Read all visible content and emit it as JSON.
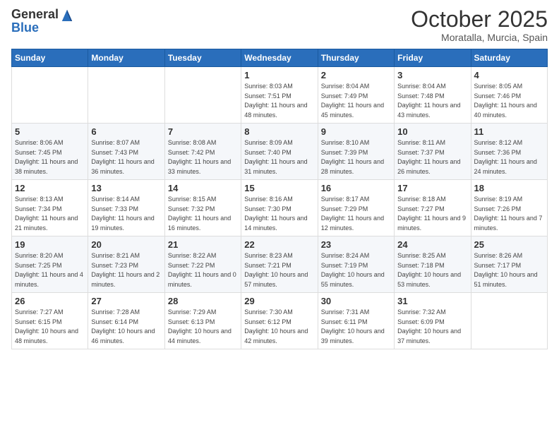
{
  "header": {
    "logo_general": "General",
    "logo_blue": "Blue",
    "month": "October 2025",
    "location": "Moratalla, Murcia, Spain"
  },
  "days_of_week": [
    "Sunday",
    "Monday",
    "Tuesday",
    "Wednesday",
    "Thursday",
    "Friday",
    "Saturday"
  ],
  "weeks": [
    [
      {
        "day": "",
        "sunrise": "",
        "sunset": "",
        "daylight": ""
      },
      {
        "day": "",
        "sunrise": "",
        "sunset": "",
        "daylight": ""
      },
      {
        "day": "",
        "sunrise": "",
        "sunset": "",
        "daylight": ""
      },
      {
        "day": "1",
        "sunrise": "Sunrise: 8:03 AM",
        "sunset": "Sunset: 7:51 PM",
        "daylight": "Daylight: 11 hours and 48 minutes."
      },
      {
        "day": "2",
        "sunrise": "Sunrise: 8:04 AM",
        "sunset": "Sunset: 7:49 PM",
        "daylight": "Daylight: 11 hours and 45 minutes."
      },
      {
        "day": "3",
        "sunrise": "Sunrise: 8:04 AM",
        "sunset": "Sunset: 7:48 PM",
        "daylight": "Daylight: 11 hours and 43 minutes."
      },
      {
        "day": "4",
        "sunrise": "Sunrise: 8:05 AM",
        "sunset": "Sunset: 7:46 PM",
        "daylight": "Daylight: 11 hours and 40 minutes."
      }
    ],
    [
      {
        "day": "5",
        "sunrise": "Sunrise: 8:06 AM",
        "sunset": "Sunset: 7:45 PM",
        "daylight": "Daylight: 11 hours and 38 minutes."
      },
      {
        "day": "6",
        "sunrise": "Sunrise: 8:07 AM",
        "sunset": "Sunset: 7:43 PM",
        "daylight": "Daylight: 11 hours and 36 minutes."
      },
      {
        "day": "7",
        "sunrise": "Sunrise: 8:08 AM",
        "sunset": "Sunset: 7:42 PM",
        "daylight": "Daylight: 11 hours and 33 minutes."
      },
      {
        "day": "8",
        "sunrise": "Sunrise: 8:09 AM",
        "sunset": "Sunset: 7:40 PM",
        "daylight": "Daylight: 11 hours and 31 minutes."
      },
      {
        "day": "9",
        "sunrise": "Sunrise: 8:10 AM",
        "sunset": "Sunset: 7:39 PM",
        "daylight": "Daylight: 11 hours and 28 minutes."
      },
      {
        "day": "10",
        "sunrise": "Sunrise: 8:11 AM",
        "sunset": "Sunset: 7:37 PM",
        "daylight": "Daylight: 11 hours and 26 minutes."
      },
      {
        "day": "11",
        "sunrise": "Sunrise: 8:12 AM",
        "sunset": "Sunset: 7:36 PM",
        "daylight": "Daylight: 11 hours and 24 minutes."
      }
    ],
    [
      {
        "day": "12",
        "sunrise": "Sunrise: 8:13 AM",
        "sunset": "Sunset: 7:34 PM",
        "daylight": "Daylight: 11 hours and 21 minutes."
      },
      {
        "day": "13",
        "sunrise": "Sunrise: 8:14 AM",
        "sunset": "Sunset: 7:33 PM",
        "daylight": "Daylight: 11 hours and 19 minutes."
      },
      {
        "day": "14",
        "sunrise": "Sunrise: 8:15 AM",
        "sunset": "Sunset: 7:32 PM",
        "daylight": "Daylight: 11 hours and 16 minutes."
      },
      {
        "day": "15",
        "sunrise": "Sunrise: 8:16 AM",
        "sunset": "Sunset: 7:30 PM",
        "daylight": "Daylight: 11 hours and 14 minutes."
      },
      {
        "day": "16",
        "sunrise": "Sunrise: 8:17 AM",
        "sunset": "Sunset: 7:29 PM",
        "daylight": "Daylight: 11 hours and 12 minutes."
      },
      {
        "day": "17",
        "sunrise": "Sunrise: 8:18 AM",
        "sunset": "Sunset: 7:27 PM",
        "daylight": "Daylight: 11 hours and 9 minutes."
      },
      {
        "day": "18",
        "sunrise": "Sunrise: 8:19 AM",
        "sunset": "Sunset: 7:26 PM",
        "daylight": "Daylight: 11 hours and 7 minutes."
      }
    ],
    [
      {
        "day": "19",
        "sunrise": "Sunrise: 8:20 AM",
        "sunset": "Sunset: 7:25 PM",
        "daylight": "Daylight: 11 hours and 4 minutes."
      },
      {
        "day": "20",
        "sunrise": "Sunrise: 8:21 AM",
        "sunset": "Sunset: 7:23 PM",
        "daylight": "Daylight: 11 hours and 2 minutes."
      },
      {
        "day": "21",
        "sunrise": "Sunrise: 8:22 AM",
        "sunset": "Sunset: 7:22 PM",
        "daylight": "Daylight: 11 hours and 0 minutes."
      },
      {
        "day": "22",
        "sunrise": "Sunrise: 8:23 AM",
        "sunset": "Sunset: 7:21 PM",
        "daylight": "Daylight: 10 hours and 57 minutes."
      },
      {
        "day": "23",
        "sunrise": "Sunrise: 8:24 AM",
        "sunset": "Sunset: 7:19 PM",
        "daylight": "Daylight: 10 hours and 55 minutes."
      },
      {
        "day": "24",
        "sunrise": "Sunrise: 8:25 AM",
        "sunset": "Sunset: 7:18 PM",
        "daylight": "Daylight: 10 hours and 53 minutes."
      },
      {
        "day": "25",
        "sunrise": "Sunrise: 8:26 AM",
        "sunset": "Sunset: 7:17 PM",
        "daylight": "Daylight: 10 hours and 51 minutes."
      }
    ],
    [
      {
        "day": "26",
        "sunrise": "Sunrise: 7:27 AM",
        "sunset": "Sunset: 6:15 PM",
        "daylight": "Daylight: 10 hours and 48 minutes."
      },
      {
        "day": "27",
        "sunrise": "Sunrise: 7:28 AM",
        "sunset": "Sunset: 6:14 PM",
        "daylight": "Daylight: 10 hours and 46 minutes."
      },
      {
        "day": "28",
        "sunrise": "Sunrise: 7:29 AM",
        "sunset": "Sunset: 6:13 PM",
        "daylight": "Daylight: 10 hours and 44 minutes."
      },
      {
        "day": "29",
        "sunrise": "Sunrise: 7:30 AM",
        "sunset": "Sunset: 6:12 PM",
        "daylight": "Daylight: 10 hours and 42 minutes."
      },
      {
        "day": "30",
        "sunrise": "Sunrise: 7:31 AM",
        "sunset": "Sunset: 6:11 PM",
        "daylight": "Daylight: 10 hours and 39 minutes."
      },
      {
        "day": "31",
        "sunrise": "Sunrise: 7:32 AM",
        "sunset": "Sunset: 6:09 PM",
        "daylight": "Daylight: 10 hours and 37 minutes."
      },
      {
        "day": "",
        "sunrise": "",
        "sunset": "",
        "daylight": ""
      }
    ]
  ]
}
